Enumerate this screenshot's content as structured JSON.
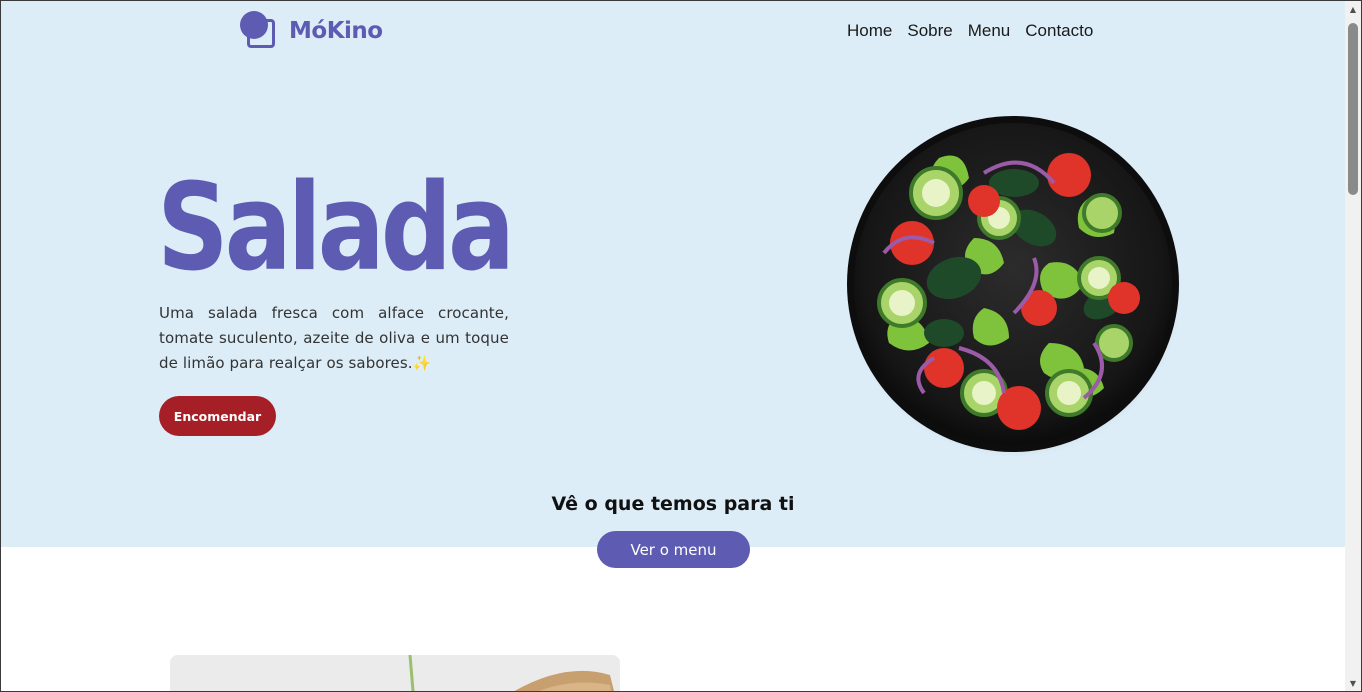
{
  "brand": {
    "name": "MóKino",
    "logo_icon": "logo-mark-icon",
    "accent_color": "#5e5bb3"
  },
  "nav": {
    "items": [
      {
        "label": "Home"
      },
      {
        "label": "Sobre"
      },
      {
        "label": "Menu"
      },
      {
        "label": "Contacto"
      }
    ]
  },
  "hero": {
    "title": "Salada",
    "description": "Uma salada fresca com alface crocante, tomate suculento, azeite de oliva e um toque de limão para realçar os sabores.",
    "sparkle": "✨",
    "order_button": "Encomendar",
    "order_button_color": "#a71f26",
    "image": "salad-bowl-image",
    "background_color": "#dcedf8"
  },
  "cta": {
    "title": "Vê o que temos para ti",
    "button": "Ver o menu"
  },
  "scrollbar": {
    "up_icon": "▲",
    "down_icon": "▼"
  }
}
